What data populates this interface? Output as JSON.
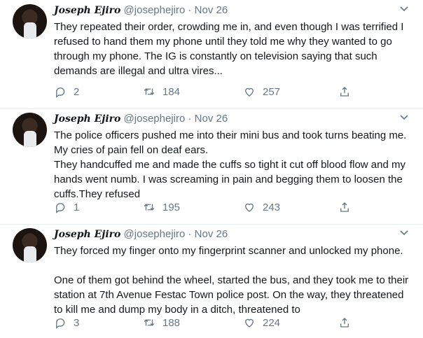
{
  "tweets": [
    {
      "name": "Joseph Ejiro",
      "handle": "@josephejiro",
      "separator": "·",
      "date": "Nov 26",
      "text": "They repeated their order, crowding me in, and  even though I was terrified I refused to hand them my phone until they told me why they wanted to go through my phone. The IG is constantly on television saying that such demands are illegal and ultra vires...",
      "replies": "2",
      "retweets": "184",
      "likes": "257"
    },
    {
      "name": "Joseph Ejiro",
      "handle": "@josephejiro",
      "separator": "·",
      "date": "Nov 26",
      "text": "The police officers pushed me into their mini bus and took turns beating me. My cries of pain fell on deaf ears.\nThey handcuffed me and made the cuffs so tight it cut off blood flow and my hands went numb. I was screaming in pain and begging them to loosen the cuffs.They refused",
      "replies": "1",
      "retweets": "195",
      "likes": "243"
    },
    {
      "name": "Joseph Ejiro",
      "handle": "@josephejiro",
      "separator": "·",
      "date": "Nov 26",
      "text": "They forced my finger onto my fingerprint scanner and unlocked my phone.\n\nOne of them got behind the wheel, started the bus, and they took me to their station at 7th Avenue Festac Town police post. On the way, they threatened to kill me and dump my body in a ditch, threatened to",
      "replies": "3",
      "retweets": "188",
      "likes": "224"
    }
  ],
  "colors": {
    "muted": "#657786",
    "text": "#14171a",
    "divider": "#e6ecf0"
  },
  "icons": [
    "reply-icon",
    "retweet-icon",
    "like-icon",
    "share-icon",
    "chevron-down-icon"
  ]
}
